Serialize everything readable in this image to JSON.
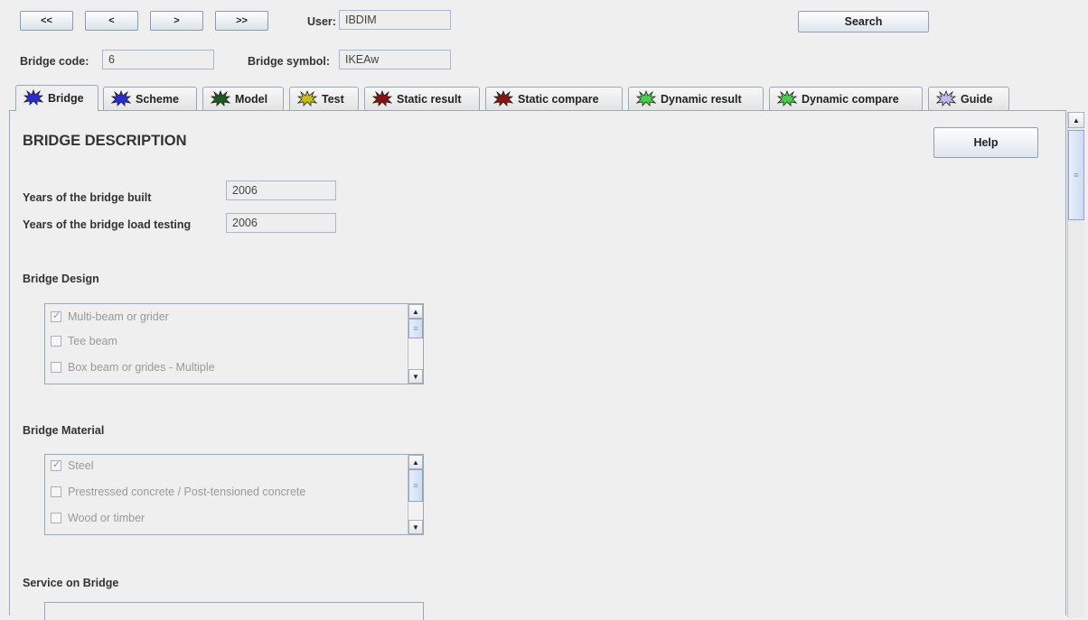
{
  "nav": {
    "first_label": "<<",
    "prev_label": "<",
    "next_label": ">",
    "last_label": ">>"
  },
  "user": {
    "label": "User:",
    "value": "IBDIM"
  },
  "search_label": "Search",
  "bridge_code": {
    "label": "Bridge code:",
    "value": "6"
  },
  "bridge_symbol": {
    "label": "Bridge symbol:",
    "value": "IKEAw"
  },
  "tabs": [
    {
      "label": "Bridge",
      "icon": "splat-icon",
      "color": "#2b2bd6"
    },
    {
      "label": "Scheme",
      "icon": "splat-icon",
      "color": "#2b2bd6"
    },
    {
      "label": "Model",
      "icon": "splat-icon",
      "color": "#1e5a1e"
    },
    {
      "label": "Test",
      "icon": "splat-icon",
      "color": "#c8c01a"
    },
    {
      "label": "Static result",
      "icon": "splat-icon",
      "color": "#8a1212"
    },
    {
      "label": "Static compare",
      "icon": "splat-icon",
      "color": "#8a1212"
    },
    {
      "label": "Dynamic result",
      "icon": "splat-icon",
      "color": "#49d049"
    },
    {
      "label": "Dynamic compare",
      "icon": "splat-icon",
      "color": "#49d049"
    },
    {
      "label": "Guide",
      "icon": "splat-icon",
      "color": "#c4b8ea"
    }
  ],
  "page": {
    "title": "BRIDGE DESCRIPTION",
    "help_label": "Help",
    "years_built": {
      "label": "Years of the bridge built",
      "value": "2006"
    },
    "years_load_testing": {
      "label": "Years of the bridge load testing",
      "value": "2006"
    },
    "bridge_design": {
      "title": "Bridge Design",
      "items": [
        {
          "label": "Multi-beam or grider",
          "checked": true
        },
        {
          "label": "Tee beam",
          "checked": false
        },
        {
          "label": "Box beam or grides - Multiple",
          "checked": false
        }
      ]
    },
    "bridge_material": {
      "title": "Bridge Material",
      "items": [
        {
          "label": "Steel",
          "checked": true
        },
        {
          "label": "Prestressed concrete / Post-tensioned concrete",
          "checked": false
        },
        {
          "label": "Wood or timber",
          "checked": false
        }
      ]
    },
    "service_on_bridge": {
      "title": "Service on Bridge"
    }
  },
  "colors": {
    "background": "#efefef",
    "border": "#9aa7b5",
    "disabled_text": "#999999"
  }
}
